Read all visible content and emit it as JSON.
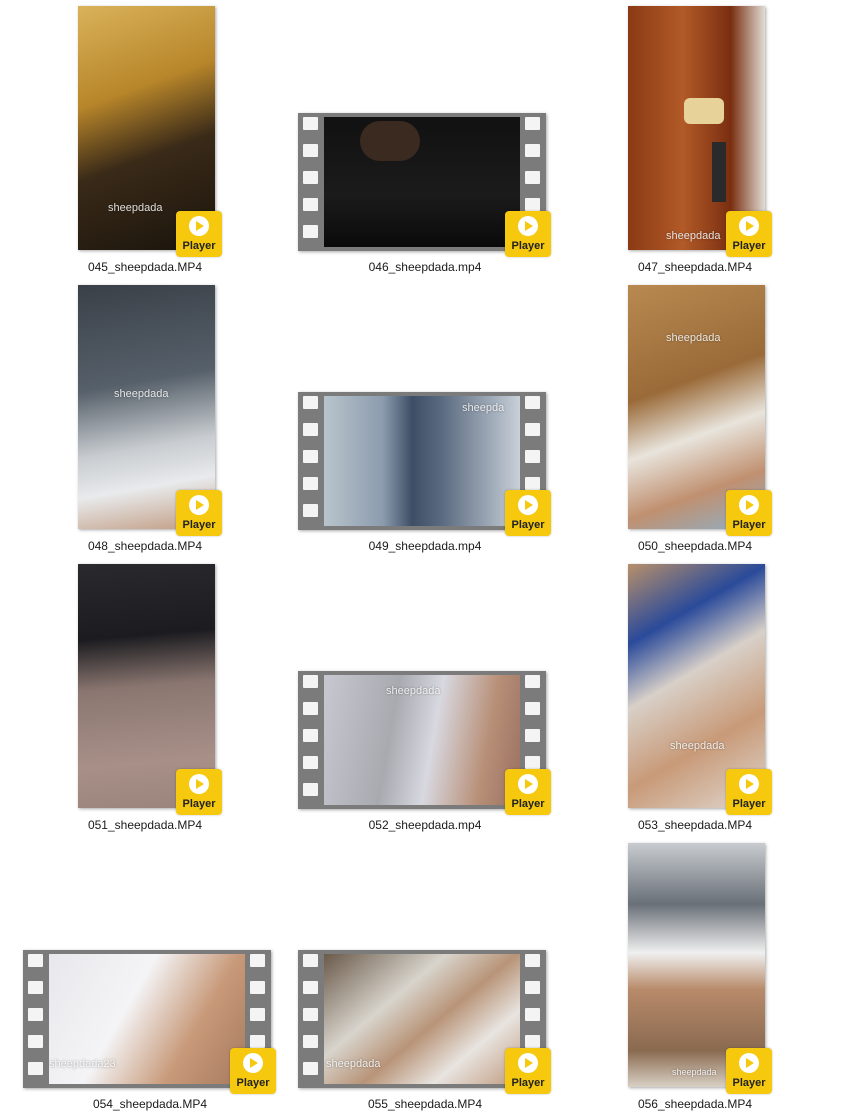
{
  "watermark": "sheepdada",
  "watermark_alt": "sheepdada23",
  "badge_label": "Player",
  "badge_color": "#f6c90e",
  "files": [
    {
      "name": "045_sheepdada.MP4",
      "kind": "portrait",
      "watermark": "sheepdada"
    },
    {
      "name": "046_sheepdada.mp4",
      "kind": "film",
      "watermark": ""
    },
    {
      "name": "047_sheepdada.MP4",
      "kind": "portrait",
      "watermark": "sheepdada"
    },
    {
      "name": "048_sheepdada.MP4",
      "kind": "portrait",
      "watermark": "sheepdada"
    },
    {
      "name": "049_sheepdada.mp4",
      "kind": "film",
      "watermark": "sheepda"
    },
    {
      "name": "050_sheepdada.MP4",
      "kind": "portrait",
      "watermark": "sheepdada"
    },
    {
      "name": "051_sheepdada.MP4",
      "kind": "portrait",
      "watermark": ""
    },
    {
      "name": "052_sheepdada.mp4",
      "kind": "film",
      "watermark": "sheepdada"
    },
    {
      "name": "053_sheepdada.MP4",
      "kind": "portrait",
      "watermark": "sheepdada"
    },
    {
      "name": "054_sheepdada.MP4",
      "kind": "film",
      "watermark": "sheepdada23"
    },
    {
      "name": "055_sheepdada.MP4",
      "kind": "film",
      "watermark": "sheepdada"
    },
    {
      "name": "056_sheepdada.MP4",
      "kind": "portrait",
      "watermark": "sheepdada"
    }
  ]
}
